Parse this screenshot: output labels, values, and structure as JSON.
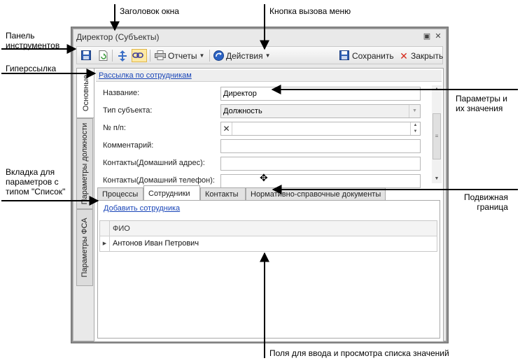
{
  "callouts": {
    "window_title": "Заголовок окна",
    "menu_button": "Кнопка вызова меню",
    "toolbar_line1": "Панель",
    "toolbar_line2": "инструментов",
    "hyperlink": "Гиперссылка",
    "params_line1": "Параметры и",
    "params_line2": "их значения",
    "list_tab_line1": "Вкладка для",
    "list_tab_line2": "параметров с",
    "list_tab_line3": "типом \"Список\"",
    "splitter_line1": "Подвижная",
    "splitter_line2": "граница",
    "fields": "Поля для ввода и просмотра списка значений"
  },
  "window": {
    "title": "Директор (Субъекты)",
    "restore_glyph": "▣",
    "close_glyph": "✕"
  },
  "toolbar": {
    "reports_label": "Отчеты",
    "actions_label": "Действия",
    "save_label": "Сохранить",
    "close_label": "Закрыть"
  },
  "vertical_tabs": [
    "Основные",
    "Параметры должности",
    "Параметры ФСА"
  ],
  "hyperlink_text": "Рассылка по сотрудникам",
  "params": [
    {
      "label": "Название:",
      "value": "Директор"
    },
    {
      "label": "Тип субъекта:",
      "value": "Должность"
    },
    {
      "label": "№ п/п:",
      "value": ""
    },
    {
      "label": "Комментарий:",
      "value": ""
    },
    {
      "label": "Контакты(Домашний адрес):",
      "value": ""
    },
    {
      "label": "Контакты(Домашний телефон):",
      "value": ""
    }
  ],
  "tabs": [
    "Процессы",
    "Сотрудники",
    "Контакты",
    "Нормативно-справочные документы"
  ],
  "active_tab": "Сотрудники",
  "employees": {
    "add_link": "Добавить сотрудника",
    "column_header": "ФИО",
    "rows": [
      "Антонов Иван Петрович"
    ]
  },
  "colors": {
    "link": "#1a46b8",
    "accent_pressed": "#fde9a4",
    "save_icon": "#2f5fb3",
    "close_icon": "#d62a1c"
  }
}
